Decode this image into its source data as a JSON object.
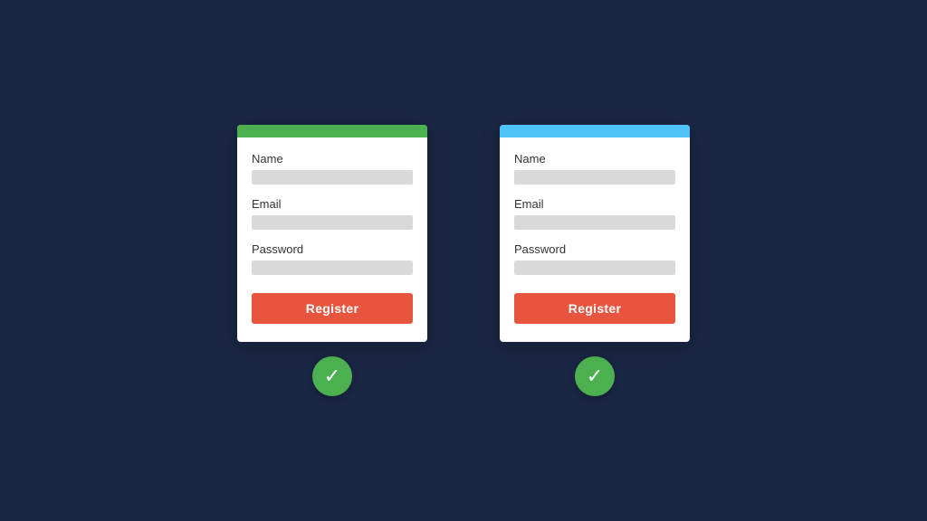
{
  "forms": [
    {
      "id": "form-left",
      "header_color": "green",
      "fields": [
        {
          "label": "Name",
          "id": "name-left"
        },
        {
          "label": "Email",
          "id": "email-left"
        },
        {
          "label": "Password",
          "id": "password-left"
        }
      ],
      "button_label": "Register",
      "checkmark_alt": "valid"
    },
    {
      "id": "form-right",
      "header_color": "blue",
      "fields": [
        {
          "label": "Name",
          "id": "name-right"
        },
        {
          "label": "Email",
          "id": "email-right"
        },
        {
          "label": "Password",
          "id": "password-right"
        }
      ],
      "button_label": "Register",
      "checkmark_alt": "valid"
    }
  ],
  "colors": {
    "background": "#1a2744",
    "header_green": "#4caf50",
    "header_blue": "#4fc3f7",
    "input_bg": "#d9d9d9",
    "register_btn": "#e8553e",
    "checkmark_bg": "#4caf50"
  }
}
